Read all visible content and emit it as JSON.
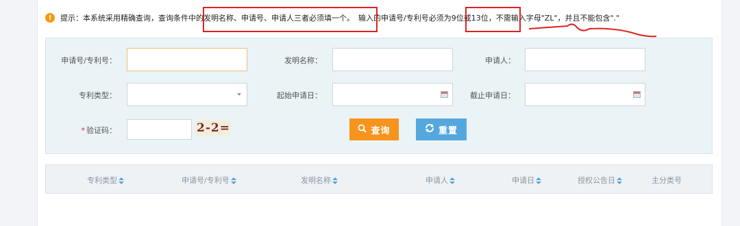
{
  "notice": {
    "icon": "warning-circle-icon",
    "p1": "提示：本系统采用精确查询，查询条件中",
    "p2": "的发明名称、申请号、申请人三者必须填一个。",
    "p3": "输入的申请号/专利号必须",
    "p4": "为9位或13位，",
    "p5": "不需输入字母\"ZL\"，并且不能包含\".\""
  },
  "form": {
    "app_no_label": "申请号/专利号：",
    "invention_name_label": "发明名称：",
    "applicant_label": "申请人：",
    "patent_type_label": "专利类型：",
    "start_date_label": "起始申请日：",
    "end_date_label": "截止申请日：",
    "captcha_label": "验证码：",
    "captcha_required_mark": "*",
    "captcha_text": "2-2=",
    "app_no_value": "",
    "invention_name_value": "",
    "applicant_value": "",
    "patent_type_value": "",
    "start_date_value": "",
    "end_date_value": "",
    "captcha_value": ""
  },
  "buttons": {
    "search_icon": "search-icon",
    "search_label": "查询",
    "reset_icon": "refresh-icon",
    "reset_label": "重置"
  },
  "table": {
    "columns": [
      "专利类型",
      "申请号/专利号",
      "发明名称",
      "申请人",
      "申请日",
      "授权公告日",
      "主分类号"
    ],
    "rows": []
  },
  "colors": {
    "annotation_red": "#e02020",
    "search_button": "#f7941d",
    "reset_button": "#54a8de",
    "panel_bg": "#eaf3f6"
  }
}
